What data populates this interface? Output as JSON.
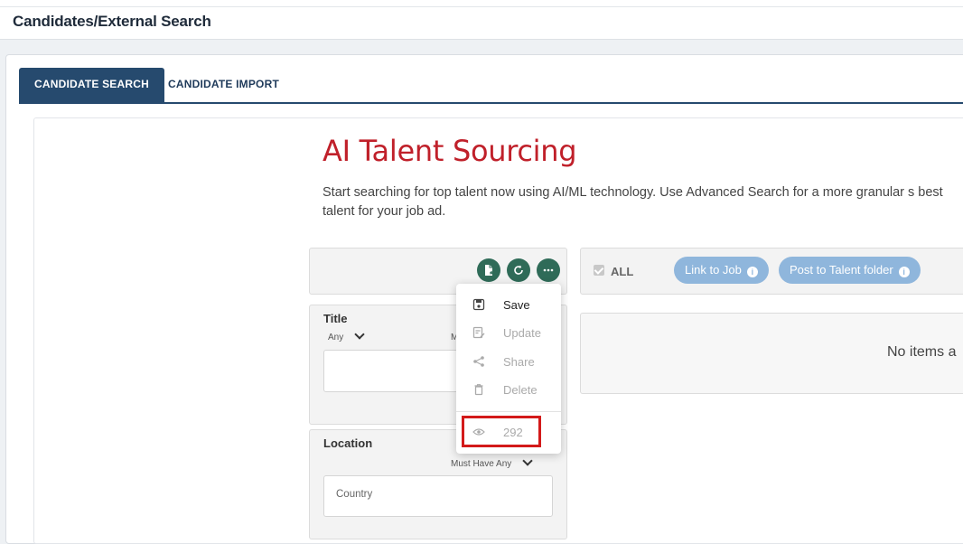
{
  "header": {
    "title": "Candidates/External Search"
  },
  "tabs": [
    {
      "label": "CANDIDATE SEARCH",
      "active": true
    },
    {
      "label": "CANDIDATE IMPORT",
      "active": false
    }
  ],
  "hero": {
    "title": "AI Talent Sourcing",
    "description": "Start searching for top talent now using AI/ML technology. Use Advanced Search for a more granular s best talent for your job ad."
  },
  "toolbar": {
    "buttons": [
      {
        "icon": "document-icon"
      },
      {
        "icon": "refresh-icon"
      },
      {
        "icon": "more-icon",
        "label": "..."
      }
    ]
  },
  "menu": {
    "items": [
      {
        "label": "Save",
        "icon": "save-icon",
        "enabled": true
      },
      {
        "label": "Update",
        "icon": "update-icon",
        "enabled": false
      },
      {
        "label": "Share",
        "icon": "share-icon",
        "enabled": false
      },
      {
        "label": "Delete",
        "icon": "trash-icon",
        "enabled": false
      }
    ],
    "views": {
      "icon": "eye-icon",
      "count": "292"
    }
  },
  "results": {
    "select_all_label": "ALL",
    "actions": [
      {
        "label": "Link to Job"
      },
      {
        "label": "Post to Talent folder"
      }
    ],
    "empty_text": "No items a"
  },
  "filters": {
    "title": {
      "label": "Title",
      "mode": "Any",
      "mode2": "M"
    },
    "location": {
      "label": "Location",
      "mode": "Must Have Any",
      "country_placeholder": "Country"
    }
  },
  "colors": {
    "tab_active": "#264a6e",
    "title_red": "#c0202a",
    "round_button": "#2f6b58",
    "pill": "#8fb6dc",
    "highlight_border": "#d31a1a"
  }
}
